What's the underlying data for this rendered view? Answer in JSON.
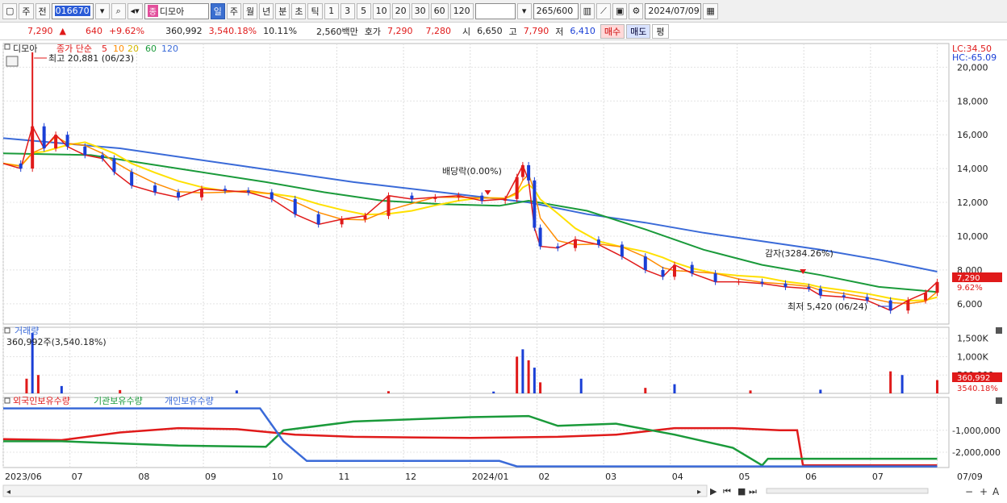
{
  "toolbar": {
    "period_main": "주",
    "period_prev": "전",
    "code": "016670",
    "stock_name": "디모아",
    "name_tag": "종",
    "periods": [
      "일",
      "주",
      "월",
      "년",
      "분",
      "초",
      "틱"
    ],
    "active_period": "일",
    "multipliers": [
      "1",
      "3",
      "5",
      "10",
      "20",
      "30",
      "60",
      "120"
    ],
    "count": "265",
    "count_max": "/600",
    "date": "2024/07/09"
  },
  "quote": {
    "price": "7,290",
    "change": "640",
    "change_pct": "+9.62%",
    "volume": "360,992",
    "volume_ratio": "3,540.18%",
    "turnover": "10.11%",
    "amount": "2,560백만",
    "bid_label": "호가",
    "bid1": "7,290",
    "bid2": "7,280",
    "open_label": "시",
    "open": "6,650",
    "high_label": "고",
    "high": "7,790",
    "low_label": "저",
    "low": "6,410",
    "buy_label": "매수",
    "sell_label": "매도",
    "eval_label": "평"
  },
  "colors": {
    "up": "#e01a1a",
    "down": "#1a3fd6",
    "ma5": "#e01a1a",
    "ma10": "#ff8c00",
    "ma20": "#ffe000",
    "ma60": "#1a9a3a",
    "ma120": "#3a6ad8",
    "foreign": "#e01a1a",
    "institution": "#1a9a3a",
    "individual": "#3a6ad8"
  },
  "chart_data": [
    {
      "type": "candlestick",
      "title_name": "디모아",
      "legend": {
        "prefix": "종가 단순",
        "periods": [
          "5",
          "10",
          "20",
          "60",
          "120"
        ]
      },
      "lc_label": "LC:34.50",
      "hc_label": "HC:-65.09",
      "y_ticks": [
        6000,
        8000,
        10000,
        12000,
        14000,
        16000,
        18000,
        20000
      ],
      "y_tick_labels": [
        "6,000",
        "8,000",
        "10,000",
        "12,000",
        "14,000",
        "16,000",
        "18,000",
        "20,000"
      ],
      "ylim": [
        4800,
        21400
      ],
      "current_price_label": "7,290",
      "current_change_label": "9.62%",
      "annotations": {
        "high": "최고 20,881 (06/23)",
        "low": "최저 5,420 (06/24)",
        "dividend": "배당락(0.00%)",
        "capital_reduction": "감자(3284.26%)"
      },
      "x_labels": [
        "2023/06",
        "07",
        "08",
        "09",
        "10",
        "11",
        "12",
        "2024/01",
        "02",
        "03",
        "04",
        "05",
        "06",
        "07",
        "07/09"
      ],
      "close_series": [
        {
          "t": 0,
          "v": 14300
        },
        {
          "t": 3,
          "v": 14000
        },
        {
          "t": 5,
          "v": 16500
        },
        {
          "t": 7,
          "v": 15200
        },
        {
          "t": 9,
          "v": 16000
        },
        {
          "t": 11,
          "v": 15300
        },
        {
          "t": 14,
          "v": 14800
        },
        {
          "t": 17,
          "v": 14600
        },
        {
          "t": 19,
          "v": 13800
        },
        {
          "t": 22,
          "v": 13000
        },
        {
          "t": 26,
          "v": 12600
        },
        {
          "t": 30,
          "v": 12300
        },
        {
          "t": 34,
          "v": 12800
        },
        {
          "t": 38,
          "v": 12700
        },
        {
          "t": 42,
          "v": 12600
        },
        {
          "t": 46,
          "v": 12200
        },
        {
          "t": 50,
          "v": 11300
        },
        {
          "t": 54,
          "v": 10700
        },
        {
          "t": 58,
          "v": 11000
        },
        {
          "t": 62,
          "v": 11200
        },
        {
          "t": 66,
          "v": 12400
        },
        {
          "t": 70,
          "v": 12200
        },
        {
          "t": 74,
          "v": 12300
        },
        {
          "t": 78,
          "v": 12400
        },
        {
          "t": 82,
          "v": 12100
        },
        {
          "t": 86,
          "v": 12200
        },
        {
          "t": 88,
          "v": 13500
        },
        {
          "t": 89,
          "v": 14200
        },
        {
          "t": 90,
          "v": 13300
        },
        {
          "t": 91,
          "v": 10500
        },
        {
          "t": 92,
          "v": 9400
        },
        {
          "t": 95,
          "v": 9300
        },
        {
          "t": 98,
          "v": 9800
        },
        {
          "t": 102,
          "v": 9500
        },
        {
          "t": 106,
          "v": 8800
        },
        {
          "t": 110,
          "v": 8000
        },
        {
          "t": 113,
          "v": 7600
        },
        {
          "t": 115,
          "v": 8300
        },
        {
          "t": 118,
          "v": 7800
        },
        {
          "t": 122,
          "v": 7300
        },
        {
          "t": 126,
          "v": 7300
        },
        {
          "t": 130,
          "v": 7200
        },
        {
          "t": 134,
          "v": 7000
        },
        {
          "t": 138,
          "v": 6900
        },
        {
          "t": 140,
          "v": 6500
        },
        {
          "t": 144,
          "v": 6400
        },
        {
          "t": 148,
          "v": 6200
        },
        {
          "t": 152,
          "v": 5600
        },
        {
          "t": 155,
          "v": 6200
        },
        {
          "t": 158,
          "v": 6650
        },
        {
          "t": 160,
          "v": 7290
        }
      ],
      "ma120_series": [
        {
          "t": 0,
          "v": 15800
        },
        {
          "t": 20,
          "v": 15200
        },
        {
          "t": 40,
          "v": 14200
        },
        {
          "t": 60,
          "v": 13200
        },
        {
          "t": 80,
          "v": 12400
        },
        {
          "t": 90,
          "v": 12000
        },
        {
          "t": 100,
          "v": 11300
        },
        {
          "t": 110,
          "v": 10800
        },
        {
          "t": 120,
          "v": 10200
        },
        {
          "t": 130,
          "v": 9700
        },
        {
          "t": 140,
          "v": 9200
        },
        {
          "t": 150,
          "v": 8600
        },
        {
          "t": 160,
          "v": 7900
        }
      ],
      "ma60_series": [
        {
          "t": 0,
          "v": 14900
        },
        {
          "t": 15,
          "v": 14800
        },
        {
          "t": 30,
          "v": 14000
        },
        {
          "t": 45,
          "v": 13200
        },
        {
          "t": 55,
          "v": 12600
        },
        {
          "t": 65,
          "v": 12100
        },
        {
          "t": 75,
          "v": 11900
        },
        {
          "t": 85,
          "v": 11800
        },
        {
          "t": 90,
          "v": 12100
        },
        {
          "t": 100,
          "v": 11500
        },
        {
          "t": 110,
          "v": 10400
        },
        {
          "t": 120,
          "v": 9200
        },
        {
          "t": 130,
          "v": 8300
        },
        {
          "t": 140,
          "v": 7700
        },
        {
          "t": 150,
          "v": 7000
        },
        {
          "t": 160,
          "v": 6700
        }
      ]
    },
    {
      "type": "bar",
      "title": "거래량",
      "value_label": "360,992주(3,540.18%)",
      "y_ticks": [
        500000,
        1000000,
        1500000
      ],
      "y_tick_labels": [
        "500,000",
        "1,000K",
        "1,500K"
      ],
      "ylim": [
        0,
        1800000
      ],
      "current_label": "360,992",
      "current_pct_label": "3540.18%",
      "values": [
        {
          "t": 4,
          "v": 400000
        },
        {
          "t": 5,
          "v": 1650000
        },
        {
          "t": 6,
          "v": 500000
        },
        {
          "t": 10,
          "v": 200000
        },
        {
          "t": 20,
          "v": 90000
        },
        {
          "t": 40,
          "v": 80000
        },
        {
          "t": 66,
          "v": 60000
        },
        {
          "t": 84,
          "v": 50000
        },
        {
          "t": 88,
          "v": 1000000
        },
        {
          "t": 89,
          "v": 1200000
        },
        {
          "t": 90,
          "v": 900000
        },
        {
          "t": 91,
          "v": 700000
        },
        {
          "t": 92,
          "v": 300000
        },
        {
          "t": 99,
          "v": 400000
        },
        {
          "t": 110,
          "v": 150000
        },
        {
          "t": 115,
          "v": 250000
        },
        {
          "t": 128,
          "v": 80000
        },
        {
          "t": 140,
          "v": 100000
        },
        {
          "t": 152,
          "v": 600000
        },
        {
          "t": 154,
          "v": 500000
        },
        {
          "t": 160,
          "v": 361000
        }
      ]
    },
    {
      "type": "line",
      "legend": [
        "외국인보유수량",
        "기관보유수량",
        "개인보유수량"
      ],
      "y_ticks": [
        -1000000,
        -2000000
      ],
      "y_tick_labels": [
        "-1,000,000",
        "-2,000,000"
      ],
      "ylim": [
        -2700000,
        500000
      ],
      "series": [
        {
          "name": "외국인보유수량",
          "color_key": "foreign",
          "values": [
            {
              "t": 0,
              "v": -1400000
            },
            {
              "t": 10,
              "v": -1450000
            },
            {
              "t": 20,
              "v": -1100000
            },
            {
              "t": 30,
              "v": -900000
            },
            {
              "t": 40,
              "v": -950000
            },
            {
              "t": 50,
              "v": -1200000
            },
            {
              "t": 60,
              "v": -1300000
            },
            {
              "t": 80,
              "v": -1350000
            },
            {
              "t": 95,
              "v": -1300000
            },
            {
              "t": 105,
              "v": -1200000
            },
            {
              "t": 115,
              "v": -900000
            },
            {
              "t": 125,
              "v": -900000
            },
            {
              "t": 133,
              "v": -1000000
            },
            {
              "t": 136,
              "v": -1000000
            },
            {
              "t": 137,
              "v": -2600000
            },
            {
              "t": 160,
              "v": -2600000
            }
          ]
        },
        {
          "name": "기관보유수량",
          "color_key": "institution",
          "values": [
            {
              "t": 0,
              "v": -1500000
            },
            {
              "t": 10,
              "v": -1500000
            },
            {
              "t": 20,
              "v": -1600000
            },
            {
              "t": 30,
              "v": -1700000
            },
            {
              "t": 45,
              "v": -1750000
            },
            {
              "t": 48,
              "v": -1000000
            },
            {
              "t": 60,
              "v": -600000
            },
            {
              "t": 80,
              "v": -400000
            },
            {
              "t": 90,
              "v": -350000
            },
            {
              "t": 95,
              "v": -800000
            },
            {
              "t": 105,
              "v": -700000
            },
            {
              "t": 115,
              "v": -1200000
            },
            {
              "t": 125,
              "v": -1800000
            },
            {
              "t": 130,
              "v": -2600000
            },
            {
              "t": 131,
              "v": -2300000
            },
            {
              "t": 160,
              "v": -2300000
            }
          ]
        },
        {
          "name": "개인보유수량",
          "color_key": "individual",
          "values": [
            {
              "t": 0,
              "v": 0
            },
            {
              "t": 44,
              "v": 0
            },
            {
              "t": 48,
              "v": -1500000
            },
            {
              "t": 52,
              "v": -2400000
            },
            {
              "t": 85,
              "v": -2400000
            },
            {
              "t": 88,
              "v": -2650000
            },
            {
              "t": 160,
              "v": -2650000
            }
          ]
        }
      ]
    }
  ]
}
